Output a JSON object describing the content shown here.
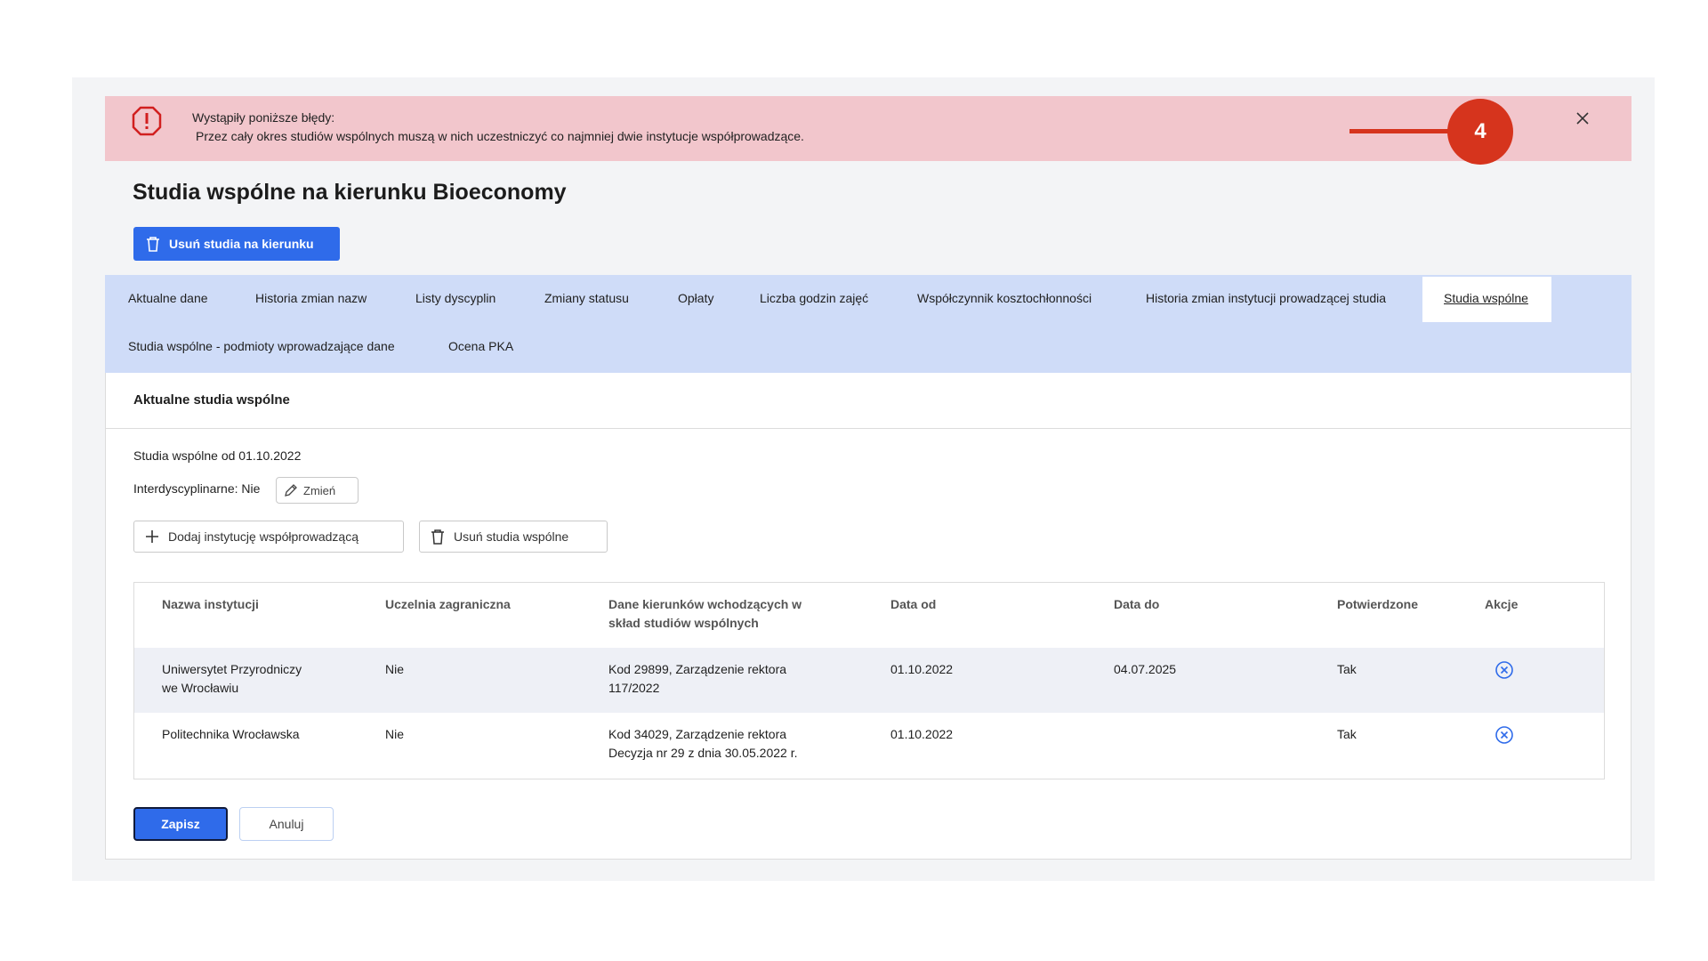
{
  "error": {
    "title": "Wystąpiły poniższe błędy:",
    "message": "Przez cały okres studiów wspólnych muszą w nich uczestniczyć co najmniej dwie instytucje współprowadzące.",
    "icon": "alert-octagon-icon",
    "color": "#f2c6cc"
  },
  "callout": {
    "number": "4",
    "color": "#d6341d"
  },
  "page": {
    "title": "Studia wspólne na kierunku Bioeconomy",
    "delete_button": "Usuń studia na kierunku",
    "accent": "#2f6bea"
  },
  "tabs": [
    {
      "label": "Aktualne dane"
    },
    {
      "label": "Historia zmian nazw"
    },
    {
      "label": "Listy dyscyplin"
    },
    {
      "label": "Zmiany statusu"
    },
    {
      "label": "Opłaty"
    },
    {
      "label": "Liczba godzin zajęć"
    },
    {
      "label": "Współczynnik kosztochłonności"
    },
    {
      "label": "Historia zmian instytucji prowadzącej studia"
    },
    {
      "label": "Studia wspólne",
      "active": true
    },
    {
      "label": "Studia wspólne - podmioty wprowadzające dane"
    },
    {
      "label": "Ocena PKA"
    }
  ],
  "section": {
    "title": "Aktualne studia wspólne",
    "since": "Studia wspólne od 01.10.2022",
    "interdisciplinary": "Interdyscyplinarne: Nie",
    "change_button": "Zmień",
    "add_button": "Dodaj instytucję współprowadzącą",
    "remove_button": "Usuń studia wspólne"
  },
  "table": {
    "headers": {
      "name": "Nazwa instytucji",
      "foreign": "Uczelnia zagraniczna",
      "fields_1": "Dane kierunków wchodzących w",
      "fields_2": "skład studiów wspólnych",
      "date_from": "Data od",
      "date_to": "Data do",
      "confirmed": "Potwierdzone",
      "actions": "Akcje"
    },
    "rows": [
      {
        "name_1": "Uniwersytet Przyrodniczy",
        "name_2": "we Wrocławiu",
        "foreign": "Nie",
        "fields_1": "Kod 29899, Zarządzenie rektora",
        "fields_2": "117/2022",
        "date_from": "01.10.2022",
        "date_to": "04.07.2025",
        "confirmed": "Tak"
      },
      {
        "name_1": "Politechnika Wrocławska",
        "name_2": "",
        "foreign": "Nie",
        "fields_1": "Kod 34029, Zarządzenie rektora",
        "fields_2": "Decyzja nr 29 z dnia 30.05.2022 r.",
        "date_from": "01.10.2022",
        "date_to": "",
        "confirmed": "Tak"
      }
    ]
  },
  "footer": {
    "save": "Zapisz",
    "cancel": "Anuluj"
  }
}
